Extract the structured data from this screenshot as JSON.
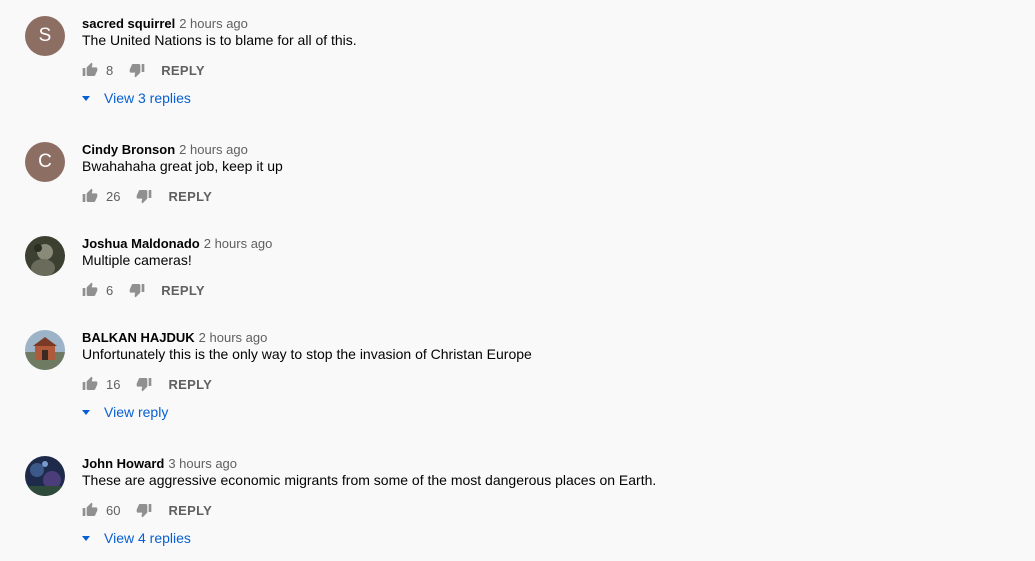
{
  "comments": [
    {
      "author": "sacred squirrel",
      "time": "2 hours ago",
      "text": "The United Nations is to blame for all of this.",
      "likes": "8",
      "reply_label": "REPLY",
      "avatar_letter": "S",
      "avatar_color": "#8d6e63",
      "view_replies": "View 3 replies"
    },
    {
      "author": "Cindy Bronson",
      "time": "2 hours ago",
      "text": "Bwahahaha  great job, keep it up",
      "likes": "26",
      "reply_label": "REPLY",
      "avatar_letter": "C",
      "avatar_color": "#8d6e63",
      "view_replies": ""
    },
    {
      "author": "Joshua Maldonado",
      "time": "2 hours ago",
      "text": "Multiple cameras!",
      "likes": "6",
      "reply_label": "REPLY",
      "avatar_letter": "",
      "avatar_color": "",
      "view_replies": ""
    },
    {
      "author": "BALKAN HAJDUK",
      "time": "2 hours ago",
      "text": "Unfortunately this is the only way to stop the invasion of Christan Europe",
      "likes": "16",
      "reply_label": "REPLY",
      "avatar_letter": "",
      "avatar_color": "",
      "view_replies": "View reply"
    },
    {
      "author": "John Howard",
      "time": "3 hours ago",
      "text": "These are aggressive economic migrants from some of the most dangerous places on Earth.",
      "likes": "60",
      "reply_label": "REPLY",
      "avatar_letter": "",
      "avatar_color": "",
      "view_replies": "View 4 replies"
    }
  ],
  "icons": {
    "like": "thumbs-up-icon",
    "dislike": "thumbs-down-icon",
    "expand": "caret-down-icon"
  },
  "colors": {
    "link": "#065fd4",
    "secondary_text": "#606060",
    "background": "#f9f9f9"
  }
}
